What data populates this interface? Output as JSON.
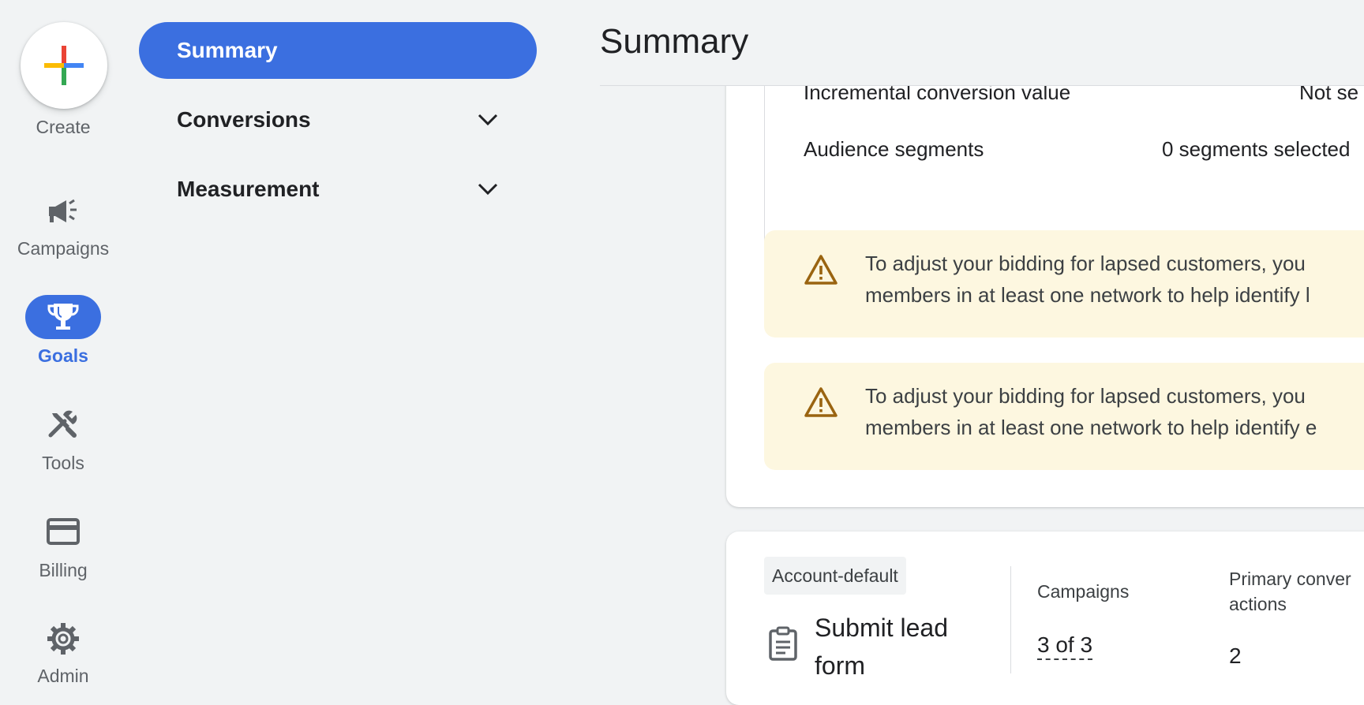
{
  "rail": {
    "create": "Create",
    "campaigns": "Campaigns",
    "goals": "Goals",
    "tools": "Tools",
    "billing": "Billing",
    "admin": "Admin"
  },
  "nav": {
    "summary": "Summary",
    "conversions": "Conversions",
    "measurement": "Measurement"
  },
  "header": {
    "title": "Summary"
  },
  "settings": {
    "rows": [
      {
        "label": "Incremental conversion value",
        "value": "Not se"
      },
      {
        "label": "Audience segments",
        "value": "0 segments selected"
      }
    ]
  },
  "warnings": [
    {
      "line1": "To adjust your bidding for lapsed customers, you",
      "line2": "members in at least one network to help identify l"
    },
    {
      "line1": "To adjust your bidding for lapsed customers, you",
      "line2": "members in at least one network to help identify e"
    }
  ],
  "goal": {
    "chip": "Account-default",
    "title": "Submit lead form",
    "campaigns_label": "Campaigns",
    "campaigns_value": "3 of 3",
    "primary_label_1": "Primary conver",
    "primary_label_2": "actions",
    "primary_value": "2"
  },
  "colors": {
    "accent": "#3b6fe0",
    "warning_bg": "#fdf7e0",
    "warning_icon": "#9a6410"
  }
}
